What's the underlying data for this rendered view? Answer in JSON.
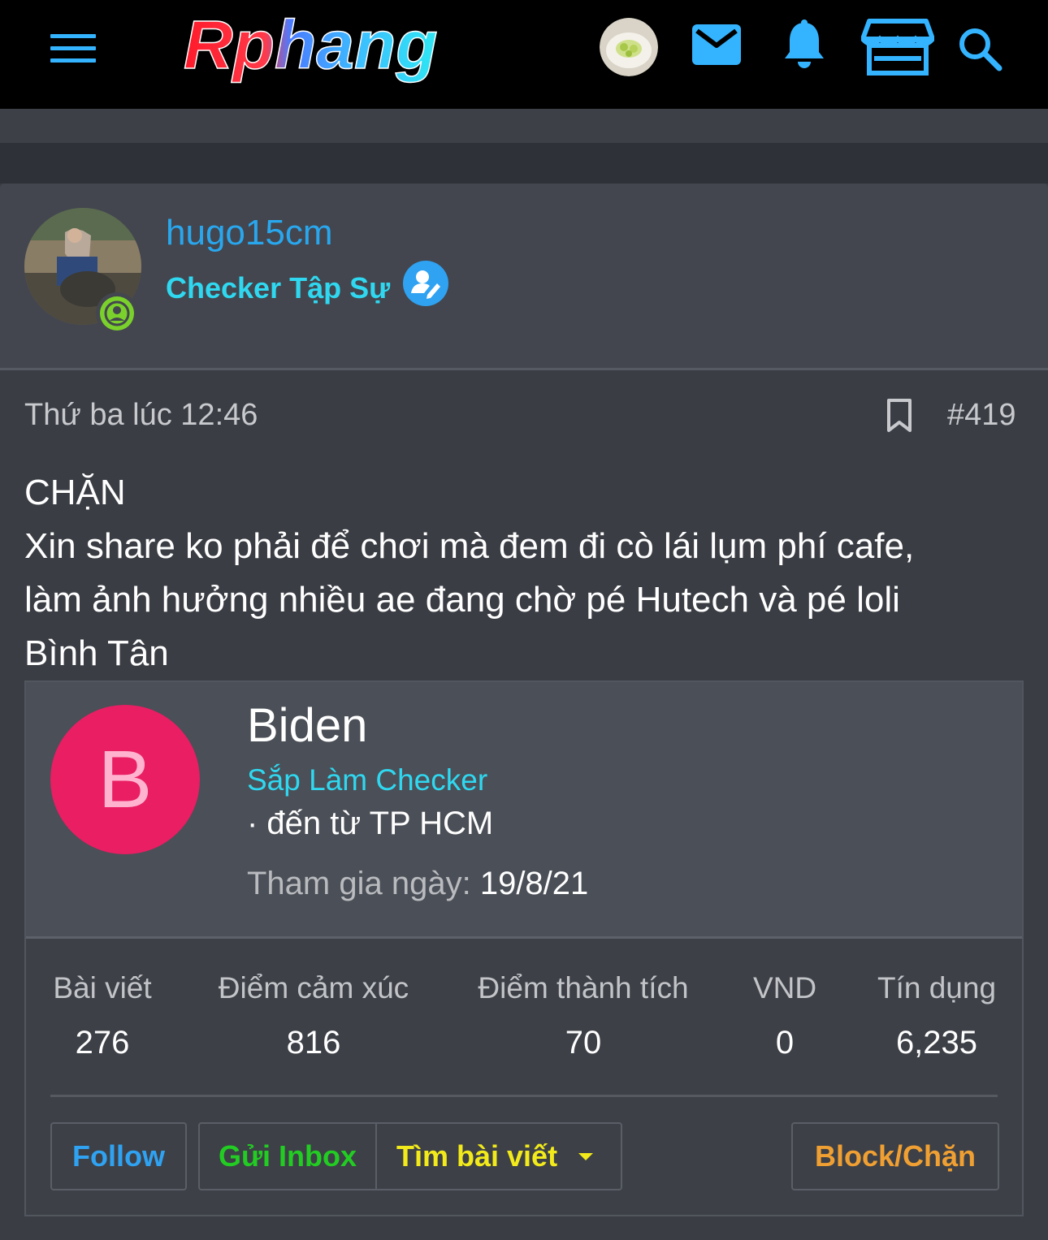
{
  "header": {
    "logo_text": "Rphang",
    "menu_icon": "hamburger-menu-icon",
    "icons": [
      "user-avatar",
      "mail-icon",
      "bell-icon",
      "store-icon",
      "search-icon"
    ],
    "accent_color": "#34b4ff"
  },
  "author": {
    "username": "hugo15cm",
    "rank": "Checker Tập Sự",
    "status_color": "#7bd12c"
  },
  "post": {
    "time": "Thứ ba lúc 12:46",
    "number": "#419",
    "title_line": "CHẶN",
    "body_lines": [
      "Xin share ko phải để chơi mà đem đi cò lái lụm phí cafe,",
      "làm ảnh hưởng nhiều ae đang chờ pé Hutech và pé loli",
      "Bình Tân"
    ]
  },
  "member_card": {
    "initial": "B",
    "name": "Biden",
    "rank": "Sắp Làm Checker",
    "from": "· đến từ TP HCM",
    "joined_label": "Tham gia ngày:",
    "joined_value": "19/8/21",
    "stats": [
      {
        "label": "Bài viết",
        "value": "276"
      },
      {
        "label": "Điểm cảm xúc",
        "value": "816"
      },
      {
        "label": "Điểm thành tích",
        "value": "70"
      },
      {
        "label": "VND",
        "value": "0"
      },
      {
        "label": "Tín dụng",
        "value": "6,235"
      }
    ],
    "buttons": {
      "follow": "Follow",
      "inbox": "Gửi Inbox",
      "find_posts": "Tìm bài viết",
      "block": "Block/Chặn"
    }
  }
}
